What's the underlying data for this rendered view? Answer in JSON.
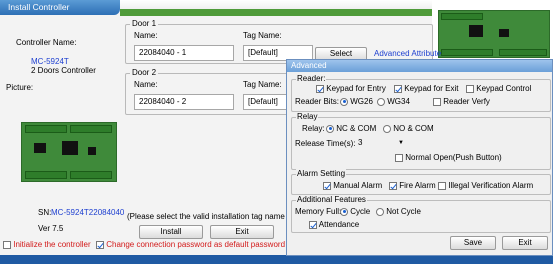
{
  "install": {
    "title": "Install Controller",
    "controller_name_label": "Controller Name:",
    "model": "MC-5924T",
    "model_desc": "2 Doors Controller",
    "picture_label": "Picture:",
    "sn_label": "SN:",
    "sn_value": "MC-5924T22084040",
    "version": "Ver 7.5",
    "install_button": "Install",
    "exit_button": "Exit",
    "hint": "(Please select the valid installation tag name for th",
    "init_label": "Initialize the controller",
    "change_pwd_label": "Change connection password as default password",
    "init_checked": false,
    "change_pwd_checked": true
  },
  "doors": [
    {
      "legend": "Door 1",
      "name_label": "Name:",
      "tag_label": "Tag Name:",
      "name_value": "22084040 - 1",
      "tag_value": "[Default]",
      "select_label": "Select",
      "advanced_label": "Advanced Attribute"
    },
    {
      "legend": "Door 2",
      "name_label": "Name:",
      "tag_label": "Tag Name:",
      "name_value": "22084040 - 2",
      "tag_value": "[Default]"
    }
  ],
  "advanced": {
    "title": "Advanced",
    "reader": {
      "legend": "Reader:",
      "keypad_entry": "Keypad for Entry",
      "keypad_exit": "Keypad for Exit",
      "keypad_control": "Keypad Control",
      "bits_label": "Reader Bits:",
      "wg26": "WG26",
      "wg34": "WG34",
      "verify": "Reader Verfy"
    },
    "relay": {
      "legend": "Relay",
      "relay_label": "Relay:",
      "nc_com": "NC & COM",
      "no_com": "NO & COM",
      "release_label": "Release Time(s):",
      "release_value": "3",
      "normal_open": "Normal Open(Push Button)"
    },
    "alarm": {
      "legend": "Alarm Setting",
      "manual": "Manual Alarm",
      "fire": "Fire Alarm",
      "illegal": "Illegal Verification Alarm"
    },
    "additional": {
      "legend": "Additional Features",
      "memory_label": "Memory Full:",
      "cycle": "Cycle",
      "not_cycle": "Not Cycle",
      "attendance": "Attendance"
    },
    "save_button": "Save",
    "exit_button": "Exit"
  },
  "colors": {
    "title_blue": "#2d6fb5",
    "accent_green": "#4f9b3a",
    "link_blue": "#1d3fd0",
    "warning_red": "#d21a1a"
  }
}
